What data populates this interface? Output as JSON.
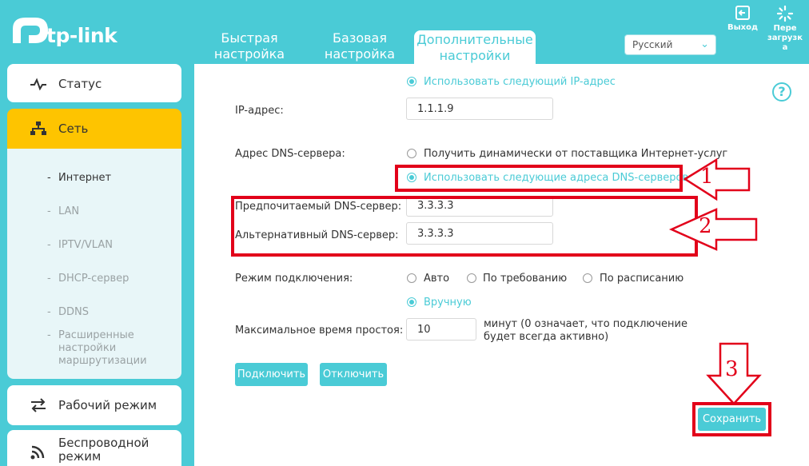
{
  "brand": {
    "name": "tp-link",
    "accent": "#4acbd6",
    "active": "#fec400",
    "marker": "#e2001a"
  },
  "nav": {
    "tabs": [
      {
        "label_l1": "Быстрая",
        "label_l2": "настройка"
      },
      {
        "label_l1": "Базовая",
        "label_l2": "настройка"
      },
      {
        "label_l1": "Дополнительные",
        "label_l2": "настройки"
      }
    ],
    "language": "Русский",
    "logout": "Выход",
    "reboot_l1": "Пере",
    "reboot_l2": "загрузк",
    "reboot_l3": "а"
  },
  "sidebar": {
    "status": "Статус",
    "network": "Сеть",
    "sub": {
      "internet": "Интернет",
      "lan": "LAN",
      "iptv": "IPTV/VLAN",
      "dhcp": "DHCP-сервер",
      "ddns": "DDNS",
      "routing_l1": "Расширенные",
      "routing_l2": "настройки",
      "routing_l3": "маршрутизации"
    },
    "mode": "Рабочий режим",
    "wireless_l1": "Беспроводной",
    "wireless_l2": "режим"
  },
  "form": {
    "use_ip": "Использовать следующий IP-адрес",
    "ip_label": "IP-адрес:",
    "ip_value": "1.1.1.9",
    "dns_label": "Адрес DNS-сервера:",
    "dns_dynamic": "Получить динамически от поставщика Интернет-услуг",
    "dns_manual": "Использовать следующие адреса DNS-серверов",
    "pref_dns_label": "Предпочитаемый DNS-сервер:",
    "pref_dns_value": "3.3.3.3",
    "alt_dns_label": "Альтернативный DNS-сервер:",
    "alt_dns_value": "3.3.3.3",
    "conn_mode_label": "Режим подключения:",
    "mode_auto": "Авто",
    "mode_demand": "По требованию",
    "mode_schedule": "По расписанию",
    "mode_manual": "Вручную",
    "idle_label": "Максимальное время простоя:",
    "idle_value": "10",
    "idle_hint_l1": "минут (0 означает, что подключение",
    "idle_hint_l2": "будет всегда активно)",
    "connect": "Подключить",
    "disconnect": "Отключить",
    "save": "Сохранить",
    "help": "?"
  },
  "annotations": {
    "n1": "1",
    "n2": "2",
    "n3": "3"
  }
}
